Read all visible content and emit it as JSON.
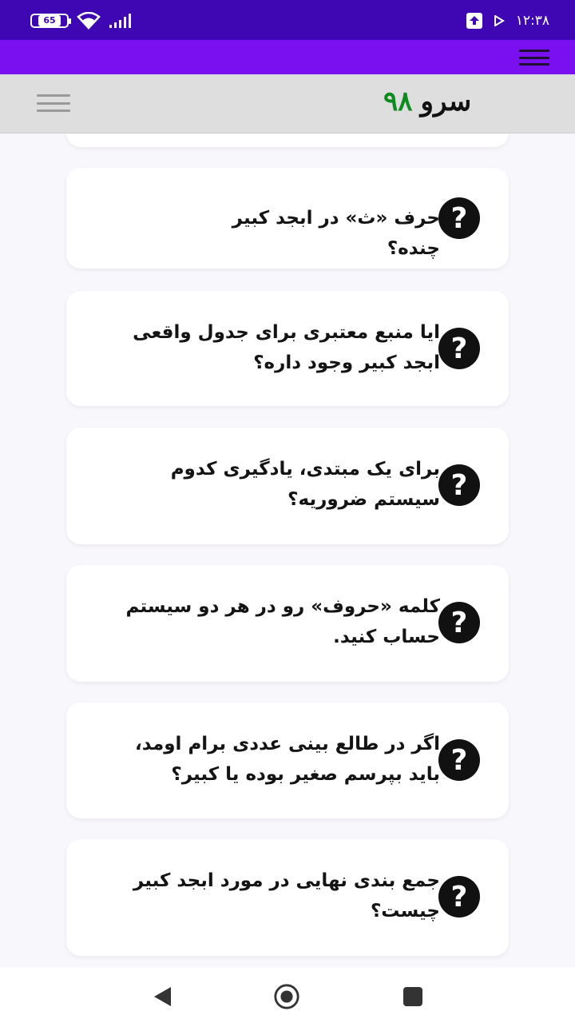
{
  "status_bar": {
    "battery_level": "65",
    "time": "۱۲:۳۸"
  },
  "header": {
    "site_name": "سرو",
    "site_number": "۹۸"
  },
  "faq": [
    {
      "question": "حرف «ث» در ابجد کبیر چنده؟"
    },
    {
      "question": "ایا منبع معتبری برای جدول واقعی ابجد کبیر وجود داره؟"
    },
    {
      "question": "برای یک مبتدی، یادگیری کدوم سیستم ضروریه؟"
    },
    {
      "question": "کلمه «حروف» رو در هر دو سیستم حساب کنید."
    },
    {
      "question": "اگر در طالع بینی عددی برام اومد، باید بپرسم صغیر بوده یا کبیر؟"
    },
    {
      "question": "جمع بندی نهایی در مورد ابجد کبیر چیست؟"
    }
  ],
  "icons": {
    "question": "?"
  }
}
